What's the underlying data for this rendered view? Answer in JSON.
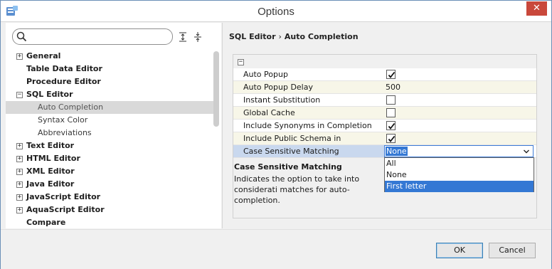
{
  "window": {
    "title": "Options",
    "close_glyph": "✕"
  },
  "search": {
    "value": "",
    "placeholder": ""
  },
  "tree": {
    "items": [
      {
        "label": "General",
        "expander": "+",
        "level": 0
      },
      {
        "label": "Table Data Editor",
        "expander": "",
        "level": 0
      },
      {
        "label": "Procedure Editor",
        "expander": "",
        "level": 0
      },
      {
        "label": "SQL Editor",
        "expander": "−",
        "level": 0
      },
      {
        "label": "Auto Completion",
        "expander": "",
        "level": 1,
        "selected": true
      },
      {
        "label": "Syntax Color",
        "expander": "",
        "level": 1
      },
      {
        "label": "Abbreviations",
        "expander": "",
        "level": 1
      },
      {
        "label": "Text Editor",
        "expander": "+",
        "level": 0
      },
      {
        "label": "HTML Editor",
        "expander": "+",
        "level": 0
      },
      {
        "label": "XML Editor",
        "expander": "+",
        "level": 0
      },
      {
        "label": "Java Editor",
        "expander": "+",
        "level": 0
      },
      {
        "label": "JavaScript Editor",
        "expander": "+",
        "level": 0
      },
      {
        "label": "AquaScript Editor",
        "expander": "+",
        "level": 0
      },
      {
        "label": "Compare",
        "expander": "",
        "level": 0
      }
    ]
  },
  "breadcrumb": {
    "parent": "SQL Editor",
    "separator": "›",
    "current": "Auto Completion"
  },
  "properties": {
    "collapse_glyph": "−",
    "rows": [
      {
        "name": "Auto Popup",
        "type": "checkbox",
        "checked": true
      },
      {
        "name": "Auto Popup Delay",
        "type": "text",
        "value": "500"
      },
      {
        "name": "Instant Substitution",
        "type": "checkbox",
        "checked": false
      },
      {
        "name": "Global Cache",
        "type": "checkbox",
        "checked": false
      },
      {
        "name": "Include Synonyms in Completion",
        "type": "checkbox",
        "checked": true
      },
      {
        "name": "Include Public Schema in Completion",
        "type": "checkbox",
        "checked": true
      },
      {
        "name": "Case Sensitive Matching",
        "type": "combo",
        "value": "None"
      }
    ],
    "dropdown_options": [
      "All",
      "None",
      "First letter"
    ],
    "dropdown_highlighted": "First letter"
  },
  "description": {
    "title": "Case Sensitive Matching",
    "text": "Indicates the option to take into considerati matches for auto-completion."
  },
  "buttons": {
    "ok": "OK",
    "cancel": "Cancel"
  },
  "colors": {
    "selection": "#3478d4",
    "close_button": "#c9483b",
    "row_alt": "#f7f6e8"
  }
}
